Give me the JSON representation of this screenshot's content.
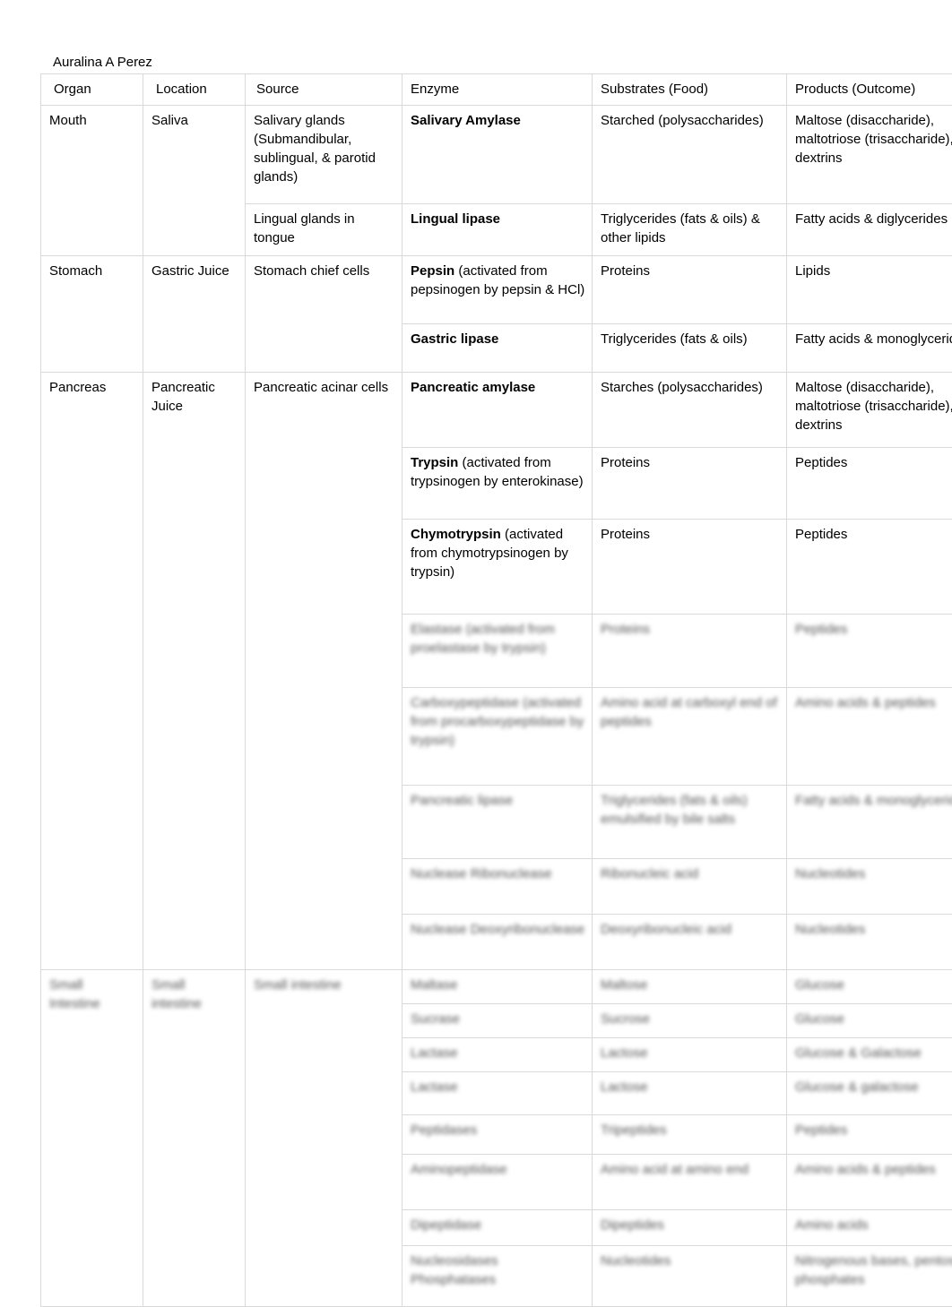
{
  "document": {
    "author": "Auralina A Perez"
  },
  "table": {
    "headers": [
      "Organ",
      "Location",
      "Source",
      "Enzyme",
      "Substrates (Food)",
      "Products (Outcome)"
    ],
    "rows": [
      {
        "organ": "Mouth",
        "location": "Saliva",
        "entries": [
          {
            "source": "Salivary glands (Submandibular, sublingual, & parotid glands)",
            "enzyme_bold": "Salivary Amylase",
            "enzyme_rest": "",
            "substrates": "Starched (polysaccharides)",
            "products": "Maltose (disaccharide), maltotriose (trisaccharide), α-dextrins"
          },
          {
            "source": "Lingual glands in tongue",
            "enzyme_bold": "Lingual lipase",
            "enzyme_rest": "",
            "substrates": "Triglycerides (fats & oils) & other lipids",
            "products": "Fatty acids & diglycerides"
          }
        ]
      },
      {
        "organ": "Stomach",
        "location": "Gastric Juice",
        "entries": [
          {
            "source": "Stomach chief cells",
            "enzyme_bold": "Pepsin ",
            "enzyme_rest": "(activated from pepsinogen by pepsin & HCl)",
            "substrates": "Proteins",
            "products": "Lipids"
          },
          {
            "source": "",
            "enzyme_bold": "Gastric lipase",
            "enzyme_rest": "",
            "substrates": "Triglycerides (fats & oils)",
            "products": "Fatty acids & monoglycerides"
          }
        ]
      },
      {
        "organ": "Pancreas",
        "location": "Pancreatic Juice",
        "entries": [
          {
            "source": "Pancreatic acinar cells",
            "enzyme_bold": "Pancreatic amylase",
            "enzyme_rest": "",
            "substrates": "Starches (polysaccharides)",
            "products": "Maltose (disaccharide), maltotriose (trisaccharide), α-dextrins"
          },
          {
            "source": "",
            "enzyme_bold": "Trypsin ",
            "enzyme_rest": "(activated from trypsinogen by enterokinase)",
            "substrates": "Proteins",
            "products": "Peptides"
          },
          {
            "source": "",
            "enzyme_bold": "Chymotrypsin ",
            "enzyme_rest": "(activated from chymotrypsinogen by trypsin)",
            "substrates": "Proteins",
            "products": "Peptides"
          }
        ]
      }
    ],
    "blurred_rows": [
      {
        "enzyme": "Elastase (activated from proelastase by trypsin)",
        "substrates": "Proteins",
        "products": "Peptides"
      },
      {
        "enzyme": "Carboxypeptidase (activated from procarboxypeptidase by trypsin)",
        "substrates": "Amino acid at carboxyl end of peptides",
        "products": "Amino acids & peptides"
      },
      {
        "enzyme": "Pancreatic lipase",
        "substrates": "Triglycerides (fats & oils) emulsified by bile salts",
        "products": "Fatty acids & monoglycerides"
      },
      {
        "enzyme": "Nuclease Ribonuclease",
        "substrates": "Ribonucleic acid",
        "products": "Nucleotides"
      },
      {
        "enzyme": "Nuclease Deoxyribonuclease",
        "substrates": "Deoxyribonucleic acid",
        "products": "Nucleotides"
      },
      {
        "enzyme": "Maltase",
        "substrates": "Maltose",
        "products": "Glucose"
      },
      {
        "enzyme": "Sucrase",
        "substrates": "Sucrose",
        "products": "Glucose"
      },
      {
        "enzyme": "Lactase",
        "substrates": "Lactose",
        "products": "Glucose & Galactose"
      },
      {
        "enzyme": "Lactase",
        "substrates": "Lactose",
        "products": "Glucose & galactose"
      },
      {
        "enzyme": "Peptidases",
        "substrates": "Tripeptides",
        "products": "Peptides"
      },
      {
        "enzyme": "Aminopeptidase",
        "substrates": "Amino acid at amino end",
        "products": "Amino acids & peptides"
      },
      {
        "enzyme": "Dipeptidase",
        "substrates": "Dipeptides",
        "products": "Amino acids"
      },
      {
        "enzyme": "Nucleosidases Phosphatases",
        "substrates": "Nucleotides",
        "products": "Nitrogenous bases, pentoses, & phosphates"
      }
    ],
    "blurred_row_label": {
      "organ": "Small Intestine",
      "location": "Small intestine",
      "source": "Small intestine"
    }
  }
}
